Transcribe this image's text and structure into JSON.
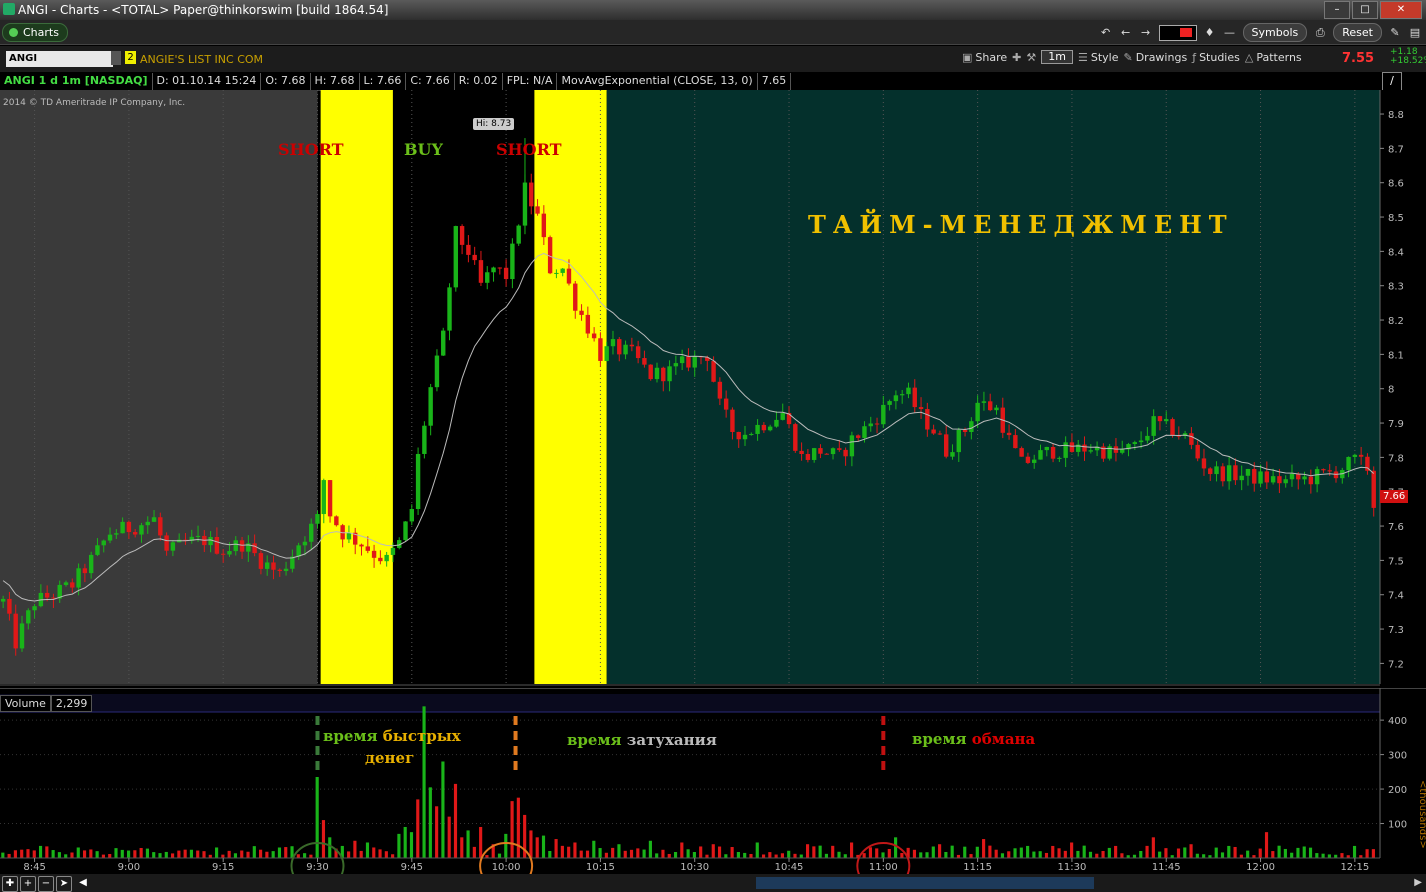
{
  "window": {
    "title": "ANGI - Charts - <TOTAL> Paper@thinkorswim [build 1864.54]"
  },
  "tab": {
    "label": "Charts"
  },
  "toolbar": {
    "symbols_label": "Symbols",
    "reset_label": "Reset"
  },
  "symbol": {
    "value": "ANGI",
    "link_group": "2",
    "company": "ANGIE'S LIST INC COM"
  },
  "chart_tools": {
    "share": "Share",
    "interval": "1m",
    "style": "Style",
    "drawings": "Drawings",
    "studies": "Studies",
    "patterns": "Patterns"
  },
  "quote": {
    "last": "7.55",
    "change": "+1.18",
    "change_pct": "+18.52%"
  },
  "info": {
    "symbol": "ANGI 1 d 1m [NASDAQ]",
    "date": "D: 01.10.14 15:24",
    "open": "O: 7.68",
    "high": "H: 7.68",
    "low": "L: 7.66",
    "close": "C: 7.66",
    "range": "R: 0.02",
    "fpl": "FPL: N/A",
    "study": "MovAvgExponential (CLOSE, 13, 0)",
    "study_value": "7.65"
  },
  "copyright": "2014 © TD Ameritrade IP Company, Inc.",
  "annotations": {
    "short1": "SHORT",
    "buy": "BUY",
    "short2": "SHORT",
    "time_mgmt": "ТАЙМ-МЕНЕДЖМЕНТ",
    "v1_a": "время ",
    "v1_b": "быстрых",
    "v1_c": "денег",
    "v2_a": "время ",
    "v2_b": "затухания",
    "v3_a": "время ",
    "v3_b": "обмана",
    "hi_label": "Hi: 8.73",
    "last_badge": "7.66"
  },
  "volume": {
    "label": "Volume",
    "value": "2,299",
    "unit": "<thousands>"
  },
  "colors": {
    "up": "#19b419",
    "down": "#e01818",
    "shade_pre": "#3a3a3a",
    "shade_black": "#000000",
    "shade_teal": "#04302c",
    "zone_yellow": "#ffff00",
    "ema": "#bbbbbb"
  },
  "chart_data": [
    {
      "type": "candlestick",
      "title": "",
      "y_ticks": [
        8.8,
        8.7,
        8.6,
        8.5,
        8.4,
        8.3,
        8.2,
        8.1,
        8,
        7.9,
        7.8,
        7.7,
        7.6,
        7.5,
        7.4,
        7.3,
        7.2
      ],
      "ylim": [
        7.14,
        8.87
      ],
      "x_ticks": [
        "8:45",
        "9:00",
        "9:15",
        "9:30",
        "9:45",
        "10:00",
        "10:15",
        "10:30",
        "10:45",
        "11:00",
        "11:15",
        "11:30",
        "11:45",
        "12:00",
        "12:15"
      ],
      "x_tick_minutes": [
        525,
        540,
        555,
        570,
        585,
        600,
        615,
        630,
        645,
        660,
        675,
        690,
        705,
        720,
        735
      ],
      "xlim_minutes": [
        519.5,
        739
      ],
      "zones_minutes": [
        {
          "from": 519.5,
          "to": 570,
          "kind": "pre"
        },
        {
          "from": 570.5,
          "to": 582,
          "kind": "short"
        },
        {
          "from": 582,
          "to": 604.5,
          "kind": "buy"
        },
        {
          "from": 604.5,
          "to": 616,
          "kind": "short"
        },
        {
          "from": 616,
          "to": 739,
          "kind": "after"
        }
      ],
      "hi": {
        "minute": 603,
        "value": 8.73
      },
      "series": [
        {
          "name": "ANGI",
          "kind": "ohlc"
        },
        {
          "name": "MovAvgExponential (CLOSE, 13, 0)",
          "kind": "line"
        }
      ],
      "keypoints": [
        [
          520,
          7.38
        ],
        [
          522,
          7.26
        ],
        [
          525,
          7.38
        ],
        [
          528,
          7.4
        ],
        [
          531,
          7.43
        ],
        [
          534,
          7.5
        ],
        [
          537,
          7.58
        ],
        [
          541,
          7.6
        ],
        [
          544,
          7.62
        ],
        [
          546,
          7.52
        ],
        [
          549,
          7.55
        ],
        [
          552,
          7.56
        ],
        [
          555,
          7.53
        ],
        [
          558,
          7.55
        ],
        [
          561,
          7.5
        ],
        [
          564,
          7.46
        ],
        [
          567,
          7.55
        ],
        [
          570,
          7.62
        ],
        [
          570.5,
          7.82
        ],
        [
          571.5,
          7.65
        ],
        [
          574,
          7.58
        ],
        [
          577,
          7.55
        ],
        [
          579,
          7.52
        ],
        [
          581,
          7.5
        ],
        [
          583,
          7.55
        ],
        [
          585,
          7.65
        ],
        [
          586,
          7.8
        ],
        [
          587,
          7.9
        ],
        [
          588,
          8.0
        ],
        [
          590,
          8.15
        ],
        [
          591,
          8.3
        ],
        [
          592,
          8.45
        ],
        [
          594,
          8.4
        ],
        [
          596,
          8.3
        ],
        [
          598,
          8.35
        ],
        [
          600,
          8.33
        ],
        [
          601,
          8.4
        ],
        [
          603,
          8.58
        ],
        [
          605,
          8.5
        ],
        [
          607,
          8.35
        ],
        [
          609,
          8.35
        ],
        [
          611,
          8.25
        ],
        [
          613,
          8.18
        ],
        [
          615,
          8.1
        ],
        [
          617,
          8.12
        ],
        [
          620,
          8.1
        ],
        [
          623,
          8.04
        ],
        [
          626,
          8.05
        ],
        [
          629,
          8.08
        ],
        [
          632,
          8.1
        ],
        [
          634,
          7.95
        ],
        [
          636,
          7.88
        ],
        [
          638,
          7.87
        ],
        [
          641,
          7.9
        ],
        [
          644,
          7.93
        ],
        [
          647,
          7.8
        ],
        [
          650,
          7.82
        ],
        [
          653,
          7.8
        ],
        [
          655,
          7.85
        ],
        [
          658,
          7.9
        ],
        [
          660,
          7.94
        ],
        [
          662,
          7.99
        ],
        [
          664,
          7.98
        ],
        [
          666,
          7.92
        ],
        [
          668,
          7.88
        ],
        [
          670,
          7.82
        ],
        [
          673,
          7.88
        ],
        [
          675,
          7.96
        ],
        [
          678,
          7.94
        ],
        [
          680,
          7.85
        ],
        [
          682,
          7.78
        ],
        [
          684,
          7.8
        ],
        [
          687,
          7.82
        ],
        [
          690,
          7.82
        ],
        [
          693,
          7.83
        ],
        [
          697,
          7.81
        ],
        [
          700,
          7.83
        ],
        [
          703,
          7.9
        ],
        [
          706,
          7.88
        ],
        [
          708,
          7.86
        ],
        [
          710,
          7.8
        ],
        [
          712,
          7.76
        ],
        [
          716,
          7.75
        ],
        [
          720,
          7.74
        ],
        [
          724,
          7.73
        ],
        [
          728,
          7.74
        ],
        [
          732,
          7.76
        ],
        [
          735,
          7.79
        ],
        [
          737,
          7.77
        ],
        [
          738,
          7.66
        ]
      ],
      "ema_start": 7.45
    },
    {
      "type": "bar",
      "title": "",
      "ylabel": "<thousands>",
      "y_ticks": [
        100,
        200,
        300,
        400
      ],
      "ylim": [
        0,
        470
      ],
      "x_ticks": [
        "8:45",
        "9:00",
        "9:15",
        "9:30",
        "9:45",
        "10:00",
        "10:15",
        "10:30",
        "10:45",
        "11:00",
        "11:15",
        "11:30",
        "11:45",
        "12:00",
        "12:15"
      ],
      "xlim_minutes": [
        519.5,
        739
      ],
      "spikes": [
        [
          570,
          235
        ],
        [
          571,
          110
        ],
        [
          572,
          60
        ],
        [
          574,
          35
        ],
        [
          576,
          50
        ],
        [
          578,
          45
        ],
        [
          580,
          25
        ],
        [
          583,
          70
        ],
        [
          584,
          90
        ],
        [
          585,
          75
        ],
        [
          586,
          170
        ],
        [
          587,
          440
        ],
        [
          588,
          205
        ],
        [
          589,
          150
        ],
        [
          590,
          280
        ],
        [
          591,
          120
        ],
        [
          592,
          215
        ],
        [
          593,
          60
        ],
        [
          594,
          80
        ],
        [
          596,
          90
        ],
        [
          598,
          40
        ],
        [
          600,
          70
        ],
        [
          601,
          165
        ],
        [
          602,
          175
        ],
        [
          603,
          125
        ],
        [
          604,
          80
        ],
        [
          605,
          60
        ],
        [
          606,
          65
        ],
        [
          608,
          55
        ],
        [
          611,
          45
        ],
        [
          614,
          50
        ],
        [
          618,
          40
        ],
        [
          623,
          50
        ],
        [
          628,
          45
        ],
        [
          633,
          40
        ],
        [
          640,
          45
        ],
        [
          648,
          40
        ],
        [
          655,
          45
        ],
        [
          662,
          60
        ],
        [
          669,
          40
        ],
        [
          676,
          55
        ],
        [
          683,
          35
        ],
        [
          690,
          45
        ],
        [
          697,
          35
        ],
        [
          703,
          60
        ],
        [
          709,
          40
        ],
        [
          715,
          35
        ],
        [
          721,
          75
        ],
        [
          728,
          30
        ],
        [
          735,
          35
        ]
      ],
      "baseline": 20
    }
  ]
}
